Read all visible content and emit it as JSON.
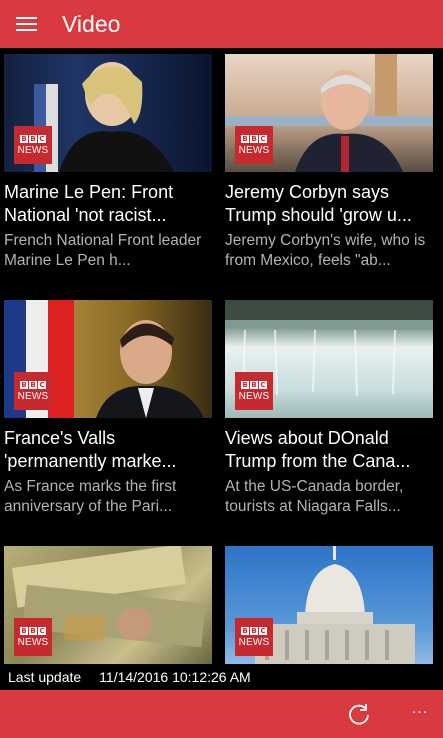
{
  "header": {
    "title": "Video"
  },
  "cards": [
    {
      "title": "Marine Le Pen: Front National 'not racist...",
      "description": "French National Front leader Marine Le Pen h...",
      "thumb_alt": "Marine Le Pen interview"
    },
    {
      "title": "Jeremy Corbyn says Trump should 'grow u...",
      "description": "Jeremy Corbyn's wife, who is from Mexico, feels \"ab...",
      "thumb_alt": "Jeremy Corbyn interview"
    },
    {
      "title": "France's Valls 'permanently marke...",
      "description": "As France marks the first anniversary of the Pari...",
      "thumb_alt": "Manuel Valls interview"
    },
    {
      "title": "Views about DOnald Trump from the Cana...",
      "description": "At the US-Canada border, tourists at Niagara Falls...",
      "thumb_alt": "Niagara Falls"
    },
    {
      "thumb_alt": "Indian rupee banknotes"
    },
    {
      "thumb_alt": "US Capitol building"
    }
  ],
  "badge": {
    "letters": [
      "B",
      "B",
      "C"
    ],
    "word": "NEWS"
  },
  "footer": {
    "label": "Last update",
    "timestamp": "11/14/2016 10:12:26 AM"
  },
  "appbar": {
    "more": "..."
  },
  "colors": {
    "accent": "#d93a3f",
    "badge": "#c62a2e",
    "muted_text": "#b3b3b3"
  }
}
